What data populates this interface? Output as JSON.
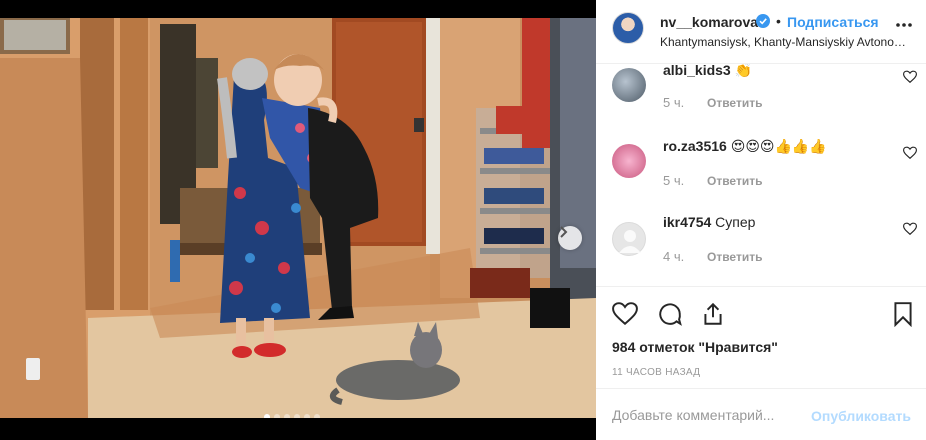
{
  "post": {
    "username": "nv__komarova",
    "bullet": "•",
    "follow_label": "Подписаться",
    "location": "Khantymansiysk, Khanty-Mansiyskiy Avtonomnyy Okrug"
  },
  "carousel": {
    "total_slides": 6,
    "active_slide": 1
  },
  "comments": [
    {
      "user": "albi_kids3",
      "text": "👏",
      "time": "5 ч.",
      "reply": "Ответить"
    },
    {
      "user": "ro.za3516",
      "text": "😍😍😍👍👍👍",
      "time": "5 ч.",
      "reply": "Ответить"
    },
    {
      "user": "ikr4754",
      "text": "Супер",
      "time": "4 ч.",
      "reply": "Ответить"
    }
  ],
  "stats": {
    "likes": "984 отметок \"Нравится\"",
    "timestamp": "11 ЧАСОВ НАЗАД"
  },
  "add_comment": {
    "placeholder": "Добавьте комментарий...",
    "publish_label": "Опубликовать"
  },
  "colors": {
    "accent": "#3897f0",
    "publish_disabled": "#b3dbff",
    "muted": "#999999",
    "text": "#262626"
  },
  "icons": [
    "verified-badge-icon",
    "more-options-icon",
    "heart-icon",
    "comment-icon",
    "share-icon",
    "bookmark-icon",
    "chevron-right-icon"
  ]
}
